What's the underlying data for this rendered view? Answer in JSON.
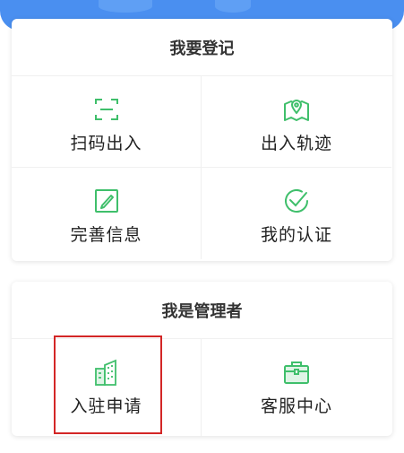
{
  "colors": {
    "accent_green": "#3fbf6b",
    "banner_blue": "#4a8ff0",
    "highlight_red": "#d32626"
  },
  "register_section": {
    "title": "我要登记",
    "items": [
      {
        "label": "扫码出入",
        "icon": "scan-icon"
      },
      {
        "label": "出入轨迹",
        "icon": "map-location-icon"
      },
      {
        "label": "完善信息",
        "icon": "edit-document-icon"
      },
      {
        "label": "我的认证",
        "icon": "check-circle-icon"
      }
    ]
  },
  "admin_section": {
    "title": "我是管理者",
    "items": [
      {
        "label": "入驻申请",
        "icon": "buildings-icon"
      },
      {
        "label": "客服中心",
        "icon": "briefcase-icon"
      }
    ]
  }
}
